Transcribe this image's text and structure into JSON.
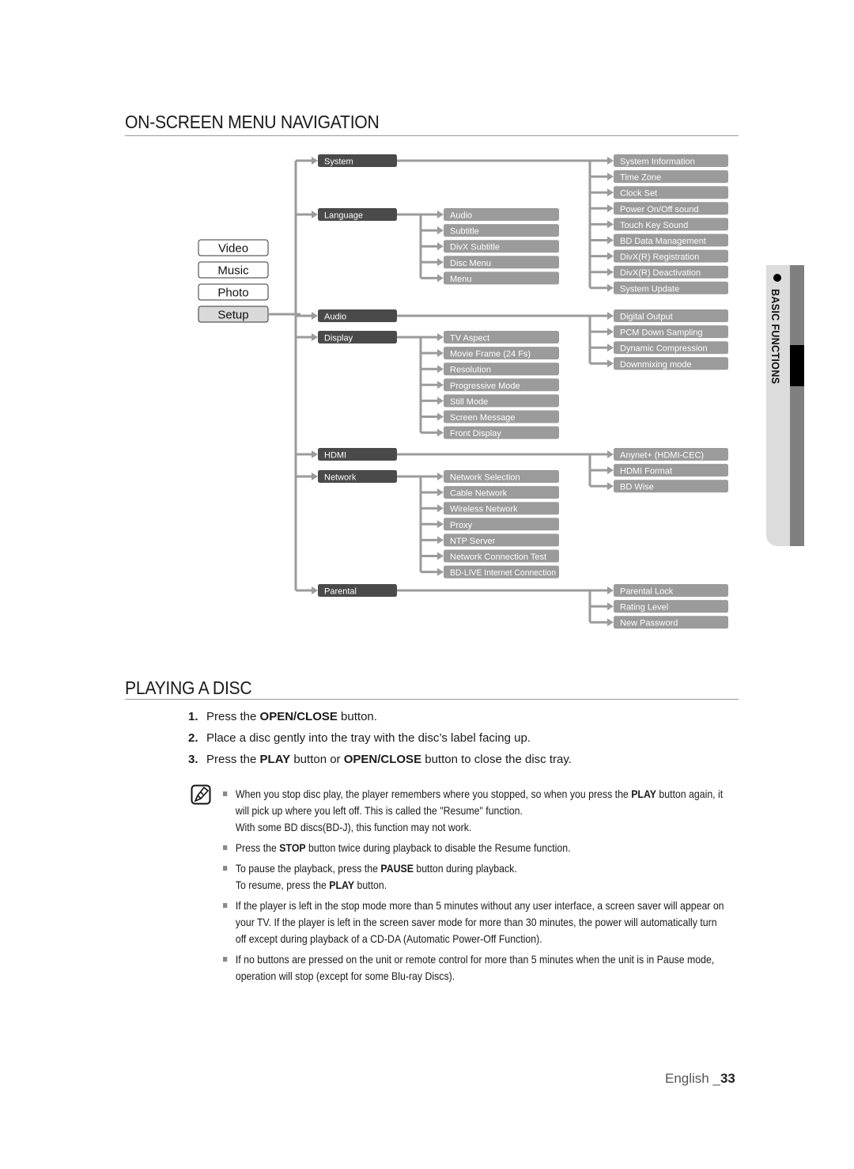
{
  "sections": {
    "menu_nav_title": "ON-SCREEN MENU NAVIGATION",
    "playing_title": "PLAYING A DISC"
  },
  "side_tab": {
    "label": "BASIC FUNCTIONS"
  },
  "main_menu": [
    "Video",
    "Music",
    "Photo",
    "Setup"
  ],
  "main_menu_selected": "Setup",
  "colors": {
    "category_box": "#4a4a4a",
    "leaf_box": "#9b9b9b",
    "connector": "#9b9b9b",
    "selected_menu": "#d9d9d9"
  },
  "setup_tree": [
    {
      "name": "System",
      "children": [
        "System Information",
        "Time Zone",
        "Clock Set",
        "Power On/Off sound",
        "Touch Key Sound",
        "BD Data Management",
        "DivX(R) Registration",
        "DivX(R) Deactivation",
        "System Update"
      ],
      "side": "right"
    },
    {
      "name": "Language",
      "children": [
        "Audio",
        "Subtitle",
        "DivX Subtitle",
        "Disc Menu",
        "Menu"
      ],
      "side": "middle"
    },
    {
      "name": "Audio",
      "children": [
        "Digital Output",
        "PCM Down Sampling",
        "Dynamic Compression",
        "Downmixing mode"
      ],
      "side": "right"
    },
    {
      "name": "Display",
      "children": [
        "TV Aspect",
        "Movie Frame (24 Fs)",
        "Resolution",
        "Progressive Mode",
        "Still Mode",
        "Screen Message",
        "Front Display"
      ],
      "side": "middle"
    },
    {
      "name": "HDMI",
      "children": [
        "Anynet+ (HDMI-CEC)",
        "HDMI Format",
        "BD Wise"
      ],
      "side": "right"
    },
    {
      "name": "Network",
      "children": [
        "Network Selection",
        "Cable Network",
        "Wireless Network",
        "Proxy",
        "NTP Server",
        "Network Connection Test",
        "BD-LIVE Internet Connection"
      ],
      "side": "middle"
    },
    {
      "name": "Parental",
      "children": [
        "Parental Lock",
        "Rating Level",
        "New Password"
      ],
      "side": "right"
    }
  ],
  "steps": [
    {
      "num": "1.",
      "parts": [
        [
          "Press the ",
          false
        ],
        [
          "OPEN/CLOSE",
          true
        ],
        [
          " button.",
          false
        ]
      ]
    },
    {
      "num": "2.",
      "parts": [
        [
          "Place a disc gently into the tray with the disc’s label facing up.",
          false
        ]
      ]
    },
    {
      "num": "3.",
      "parts": [
        [
          "Press the ",
          false
        ],
        [
          "PLAY",
          true
        ],
        [
          " button or ",
          false
        ],
        [
          "OPEN/CLOSE",
          true
        ],
        [
          " button to close the disc tray.",
          false
        ]
      ]
    }
  ],
  "notes": [
    {
      "parts": [
        [
          "When you stop disc play, the player remembers where you stopped, so when you press the ",
          false
        ],
        [
          "PLAY",
          true
        ],
        [
          " button again, it will pick up where you left off. This is called the \"Resume\" function.",
          false
        ],
        [
          "\n",
          false
        ],
        [
          "With some BD discs(BD-J), this function may not work.",
          false
        ]
      ]
    },
    {
      "parts": [
        [
          "Press the ",
          false
        ],
        [
          "STOP",
          true
        ],
        [
          " button twice during playback to disable the Resume function.",
          false
        ]
      ]
    },
    {
      "parts": [
        [
          "To pause the playback, press the ",
          false
        ],
        [
          "PAUSE",
          true
        ],
        [
          " button during playback.",
          false
        ],
        [
          "\n",
          false
        ],
        [
          "To resume, press the ",
          false
        ],
        [
          "PLAY",
          true
        ],
        [
          " button.",
          false
        ]
      ]
    },
    {
      "parts": [
        [
          "If the player is left in the stop mode more than 5 minutes without any user interface, a screen saver will appear on your TV. If the player is left in the screen saver mode for more than 30 minutes, the power will automatically turn off except during playback of a CD-DA (Automatic Power-Off Function).",
          false
        ]
      ]
    },
    {
      "parts": [
        [
          "If no buttons are pressed on the unit or remote control for more than 5 minutes when the unit is in Pause mode, operation will stop (except for some Blu-ray Discs).",
          false
        ]
      ]
    }
  ],
  "footer": {
    "language": "English _",
    "page": "33"
  }
}
